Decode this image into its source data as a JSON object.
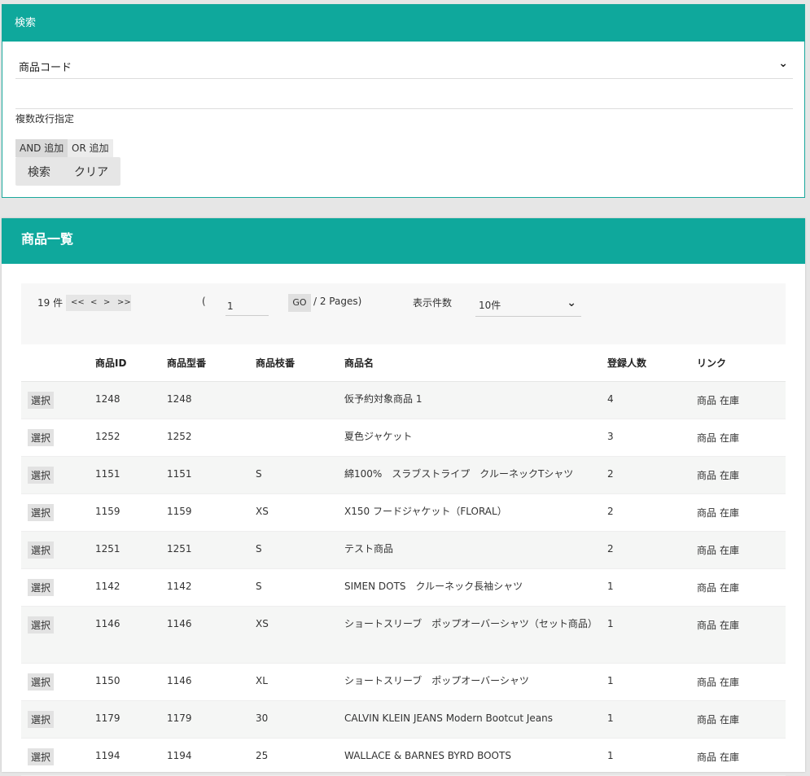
{
  "search": {
    "title": "検索",
    "field_select": "商品コード",
    "multi_label": "複数改行指定",
    "and_label": "AND 追加",
    "or_label": "OR 追加",
    "search_label": "検索",
    "clear_label": "クリア"
  },
  "list": {
    "title": "商品一覧",
    "pager": {
      "count": "19 件",
      "first": "<<",
      "prev": "<",
      "next": ">",
      "last": ">>",
      "open_paren": "(",
      "page": "1",
      "go": "GO",
      "pages": "/ 2 Pages)",
      "per_page_label": "表示件数",
      "per_page": "10件"
    },
    "columns": [
      "",
      "商品ID",
      "商品型番",
      "商品枝番",
      "商品名",
      "登録人数",
      "リンク"
    ],
    "select_label": "選択",
    "rows": [
      {
        "id": "1248",
        "model": "1248",
        "branch": "",
        "name": "仮予約対象商品 1",
        "count": "4",
        "link1": "商品",
        "link2": "在庫"
      },
      {
        "id": "1252",
        "model": "1252",
        "branch": "",
        "name": "夏色ジャケット",
        "count": "3",
        "link1": "商品",
        "link2": "在庫"
      },
      {
        "id": "1151",
        "model": "1151",
        "branch": "S",
        "name": "綿100%　スラブストライプ　クルーネックTシャツ",
        "count": "2",
        "link1": "商品",
        "link2": "在庫"
      },
      {
        "id": "1159",
        "model": "1159",
        "branch": "XS",
        "name": "X150 フードジャケット（FLORAL）",
        "count": "2",
        "link1": "商品",
        "link2": "在庫"
      },
      {
        "id": "1251",
        "model": "1251",
        "branch": "S",
        "name": "テスト商品",
        "count": "2",
        "link1": "商品",
        "link2": "在庫"
      },
      {
        "id": "1142",
        "model": "1142",
        "branch": "S",
        "name": "SIMEN DOTS　クルーネック長袖シャツ",
        "count": "1",
        "link1": "商品",
        "link2": "在庫"
      },
      {
        "id": "1146",
        "model": "1146",
        "branch": "XS",
        "name": "ショートスリーブ　ポップオーバーシャツ（セット商品）",
        "count": "1",
        "link1": "商品",
        "link2": "在庫"
      },
      {
        "id": "1150",
        "model": "1146",
        "branch": "XL",
        "name": "ショートスリーブ　ポップオーバーシャツ",
        "count": "1",
        "link1": "商品",
        "link2": "在庫"
      },
      {
        "id": "1179",
        "model": "1179",
        "branch": "30",
        "name": "CALVIN KLEIN JEANS Modern Bootcut Jeans",
        "count": "1",
        "link1": "商品",
        "link2": "在庫"
      },
      {
        "id": "1194",
        "model": "1194",
        "branch": "25",
        "name": "WALLACE & BARNES BYRD BOOTS",
        "count": "1",
        "link1": "商品",
        "link2": "在庫"
      }
    ]
  }
}
